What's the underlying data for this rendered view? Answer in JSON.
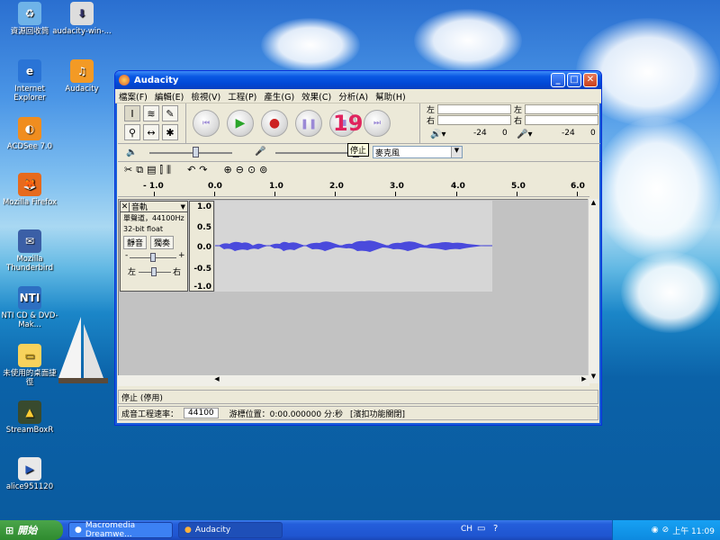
{
  "desktop": {
    "icons": [
      {
        "label": "資源回收筒",
        "name": "recycle-bin-icon"
      },
      {
        "label": "audacity-win-...",
        "name": "installer-icon"
      },
      {
        "label": "Internet Explorer",
        "name": "internet-explorer-icon"
      },
      {
        "label": "Audacity",
        "name": "audacity-icon"
      },
      {
        "label": "ACDSee 7.0",
        "name": "acdsee-icon"
      },
      {
        "label": "Mozilla Firefox",
        "name": "firefox-icon"
      },
      {
        "label": "Mozilla Thunderbird",
        "name": "thunderbird-icon"
      },
      {
        "label": "NTI CD & DVD-Mak...",
        "name": "nti-cd-icon"
      },
      {
        "label": "未使用的桌面捷徑",
        "name": "folder-icon"
      },
      {
        "label": "StreamBoxR",
        "name": "streambox-icon"
      },
      {
        "label": "alice951120",
        "name": "media-file-icon"
      }
    ]
  },
  "window": {
    "title": "Audacity",
    "menu": [
      "檔案(F)",
      "編輯(E)",
      "檢視(V)",
      "工程(P)",
      "產生(G)",
      "效果(C)",
      "分析(A)",
      "幫助(H)"
    ],
    "meters": {
      "left": "左",
      "right": "右",
      "db1": "-24",
      "zero1": "0",
      "db2": "-24",
      "zero2": "0"
    },
    "tooltip": "停止",
    "input_source": "麥克風",
    "overlay_number": "19",
    "ruler": [
      "- 1.0",
      "0.0",
      "1.0",
      "2.0",
      "3.0",
      "4.0",
      "5.0",
      "6.0"
    ],
    "track": {
      "name": "音軌",
      "info1": "單聲道，44100Hz",
      "info2": "32-bit float",
      "mute": "靜音",
      "solo": "獨奏",
      "gain_minus": "-",
      "gain_plus": "+",
      "pan_left": "左",
      "pan_right": "右",
      "yaxis": [
        "1.0",
        "0.5",
        "0.0",
        "-0.5",
        "-1.0"
      ]
    },
    "status": "停止 (停用)",
    "rate_label": "成音工程速率：",
    "rate_value": "44100",
    "cursor_text": "游標位置：0:00.000000 分:秒",
    "snap_text": "[濱扣功能關閉]"
  },
  "taskbar": {
    "start": "開始",
    "tasks": [
      "Macromedia Dreamwe...",
      "Audacity"
    ],
    "lang": "CH",
    "time": "上午 11:09"
  }
}
